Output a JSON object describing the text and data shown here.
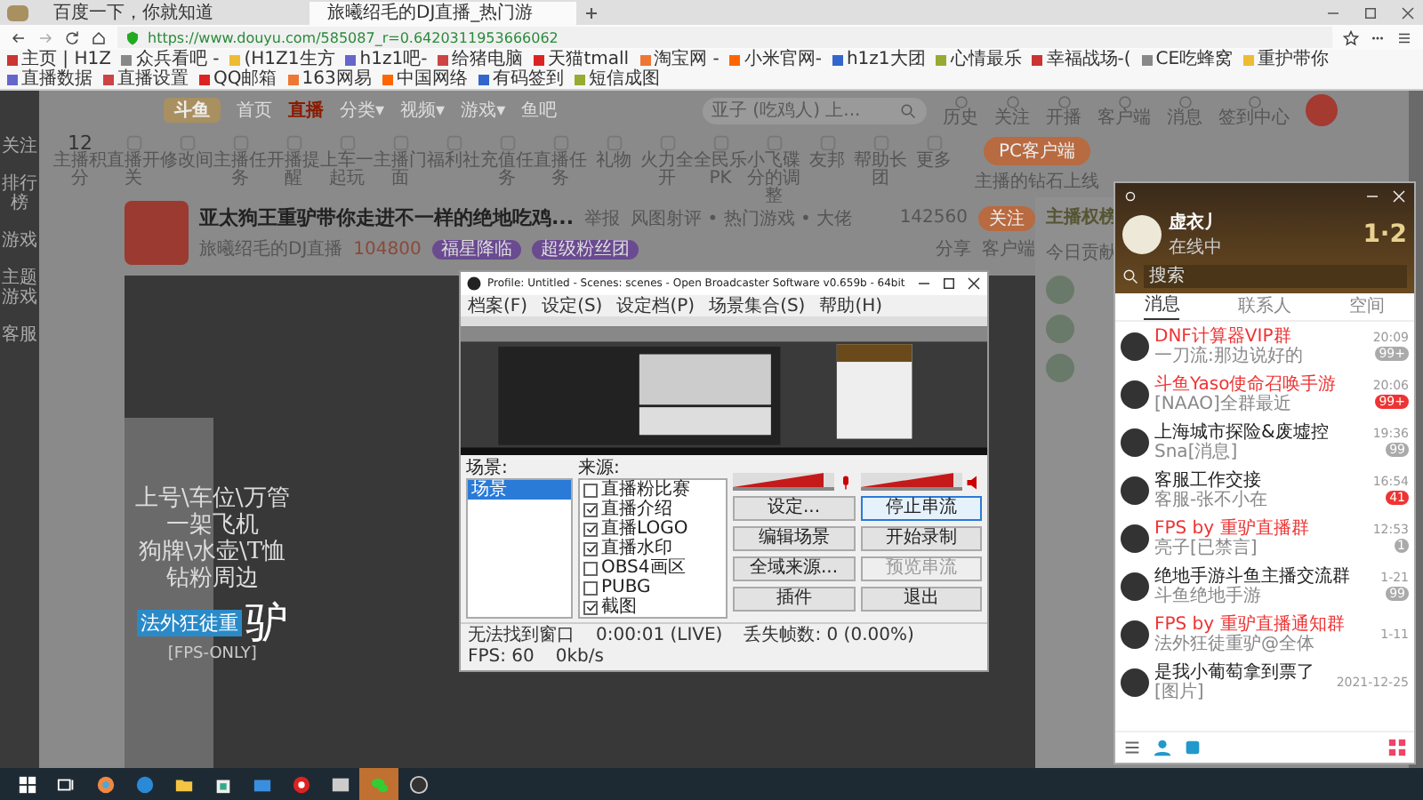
{
  "browser": {
    "tabs": [
      {
        "title": "百度一下，你就知道",
        "selected": false
      },
      {
        "title": "旅曦绍毛的DJ直播_热门游",
        "selected": true
      }
    ],
    "url": "https://www.douyu.com/585087_r=0.6420311953666062",
    "bookmarks": [
      "主页 | H1Z",
      "众兵看吧 -",
      "(H1Z1生方",
      "h1z1吧-",
      "给猪电脑",
      "天猫tmall",
      "淘宝网 -",
      "小米官网-",
      "h1z1大团",
      "心情最乐",
      "幸福战场-(",
      "CE吃蜂窝",
      "重护带你",
      "直播数据",
      "直播设置",
      "QQ邮箱",
      "163网易",
      "中国网络",
      "有码签到",
      "短信成图"
    ]
  },
  "site": {
    "logo": "斗鱼",
    "sidebar": [
      "关注",
      "排行榜",
      "游戏",
      "主题游戏",
      "客服"
    ],
    "nav": [
      {
        "label": "首页",
        "selected": false
      },
      {
        "label": "直播",
        "selected": true
      },
      {
        "label": "分类▾",
        "selected": false
      },
      {
        "label": "视频▾",
        "selected": false
      },
      {
        "label": "游戏▾",
        "selected": false
      },
      {
        "label": "鱼吧",
        "selected": false
      }
    ],
    "search": {
      "placeholder": "亚子 (吃鸡人) 上..."
    },
    "header_links": [
      "历史",
      "关注",
      "开播",
      "客户端",
      "消息",
      "签到中心"
    ],
    "toolbar": [
      {
        "kind": "count",
        "value": "12",
        "label": "主播积分"
      },
      {
        "kind": "icon",
        "label": "直播开关"
      },
      {
        "kind": "icon",
        "label": "修改间"
      },
      {
        "kind": "icon",
        "label": "主播任务"
      },
      {
        "kind": "icon",
        "label": "开播提醒"
      },
      {
        "kind": "icon",
        "label": "上车一起玩"
      },
      {
        "kind": "icon",
        "label": "主播门面"
      },
      {
        "kind": "icon",
        "label": "福利社"
      },
      {
        "kind": "icon",
        "label": "充值任务"
      },
      {
        "kind": "icon",
        "label": "直播任务"
      },
      {
        "kind": "icon",
        "label": "礼物"
      },
      {
        "kind": "icon",
        "label": "火力全开"
      },
      {
        "kind": "icon",
        "label": "全民乐PK"
      },
      {
        "kind": "icon",
        "label": "小飞碟分的调整"
      },
      {
        "kind": "icon",
        "label": "友邦"
      },
      {
        "kind": "icon",
        "label": "帮助长团"
      },
      {
        "kind": "icon",
        "label": "更多"
      }
    ],
    "pc_button": "PC客户端",
    "pc_note": "主播的钻石上线",
    "stream": {
      "title": "亚太狗王重驴带你走进不一样的绝地吃鸡...",
      "report": "举报",
      "category": "风图射评 • 热门游戏 • 大佬",
      "streamer": "旅曦绍毛的DJ直播",
      "heat": "104800",
      "badges": [
        "福星降临",
        "超级粉丝团"
      ],
      "follow_count": "142560",
      "follow": "关注",
      "actions": [
        "分享",
        "客户端"
      ]
    },
    "rank": {
      "title": "主播权榜",
      "tab": "今日贡献"
    }
  },
  "video_overlay": {
    "lines": [
      "上号\\车位\\万管",
      "一架飞机",
      "狗牌\\水壶\\T恤",
      "钻粉周边"
    ],
    "name": "法外狂徒重",
    "big": "驴",
    "tag": "[FPS-ONLY]"
  },
  "obs": {
    "title": "Profile: Untitled - Scenes: scenes - Open Broadcaster Software v0.659b - 64bit",
    "menu": [
      "档案(F)",
      "设定(S)",
      "设定档(P)",
      "场景集合(S)",
      "帮助(H)"
    ],
    "scenes_label": "场景:",
    "scenes": [
      {
        "name": "场景",
        "selected": true
      }
    ],
    "sources_label": "来源:",
    "sources": [
      {
        "name": "直播粉比赛",
        "checked": false
      },
      {
        "name": "直播介绍",
        "checked": true
      },
      {
        "name": "直播LOGO",
        "checked": true
      },
      {
        "name": "直播水印",
        "checked": true
      },
      {
        "name": "OBS4画区",
        "checked": false
      },
      {
        "name": "PUBG",
        "checked": false
      },
      {
        "name": "截图",
        "checked": true
      }
    ],
    "meters": [
      {
        "kind": "mic",
        "level": 0.9
      },
      {
        "kind": "speaker",
        "level": 0.92
      }
    ],
    "buttons": [
      {
        "label": "设定...",
        "disabled": false,
        "selected": false
      },
      {
        "label": "停止串流",
        "disabled": false,
        "selected": true
      },
      {
        "label": "编辑场景",
        "disabled": false,
        "selected": false
      },
      {
        "label": "开始录制",
        "disabled": false,
        "selected": false
      },
      {
        "label": "全域来源...",
        "disabled": false,
        "selected": false
      },
      {
        "label": "预览串流",
        "disabled": true,
        "selected": false
      },
      {
        "label": "插件",
        "disabled": false,
        "selected": false
      },
      {
        "label": "退出",
        "disabled": false,
        "selected": false
      }
    ],
    "status": [
      "无法找到窗口",
      "0:00:01 (LIVE)",
      "丢失帧数: 0 (0.00%)",
      "FPS: 60",
      "0kb/s"
    ]
  },
  "qq": {
    "name": "虚衣丿",
    "status": "在线中",
    "art_text": "1·2",
    "search": {
      "placeholder": "搜索"
    },
    "tabs": [
      {
        "label": "消息",
        "selected": true
      },
      {
        "label": "联系人",
        "selected": false
      },
      {
        "label": "空间",
        "selected": false
      }
    ],
    "chats": [
      {
        "name": "DNF计算器VIP群",
        "highlight": true,
        "time": "20:09",
        "preview": "一刀流:那边说好的",
        "badge": "99+",
        "alert": false
      },
      {
        "name": "斗鱼Yaso使命召唤手游",
        "highlight": true,
        "time": "20:06",
        "preview": "[NAAO]全群最近",
        "badge": "99+",
        "alert": true
      },
      {
        "name": "上海城市探险&废墟控",
        "highlight": false,
        "time": "19:36",
        "preview": "Sna[消息]",
        "badge": "99",
        "alert": false
      },
      {
        "name": "客服工作交接",
        "highlight": false,
        "time": "16:54",
        "preview": "客服-张不小在",
        "badge": "41",
        "alert": true
      },
      {
        "name": "FPS by 重驴直播群",
        "highlight": true,
        "time": "12:53",
        "preview": "亮子[已禁言]",
        "badge": "1",
        "alert": false
      },
      {
        "name": "绝地手游斗鱼主播交流群",
        "highlight": false,
        "time": "1-21",
        "preview": "斗鱼绝地手游",
        "badge": "99",
        "alert": false
      },
      {
        "name": "FPS by 重驴直播通知群",
        "highlight": true,
        "time": "1-11",
        "preview": "法外狂徒重驴@全体"
      },
      {
        "name": "是我小葡萄拿到票了",
        "highlight": false,
        "time": "2021-12-25",
        "preview": "[图片]"
      }
    ]
  },
  "taskbar": [
    {
      "kind": "start",
      "active": false
    },
    {
      "kind": "taskview",
      "active": false
    },
    {
      "kind": "browser",
      "active": false
    },
    {
      "kind": "edge",
      "active": false
    },
    {
      "kind": "folder",
      "active": false
    },
    {
      "kind": "store",
      "active": false
    },
    {
      "kind": "mail",
      "active": false
    },
    {
      "kind": "music",
      "active": false
    },
    {
      "kind": "app",
      "active": false
    },
    {
      "kind": "wechat",
      "active": true
    },
    {
      "kind": "obs",
      "active": false
    }
  ]
}
